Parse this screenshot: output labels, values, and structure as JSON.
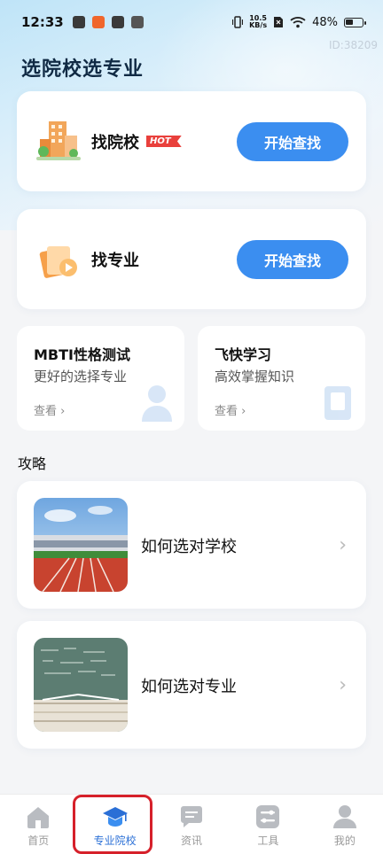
{
  "status_bar": {
    "time": "12:33",
    "net_speed_value": "10.5",
    "net_speed_unit": "KB/s",
    "battery": "48%"
  },
  "watermark": "ID:38209",
  "page_title": "选院校选专业",
  "find_school": {
    "label": "找院校",
    "badge": "HOT",
    "button": "开始查找"
  },
  "find_major": {
    "label": "找专业",
    "button": "开始查找"
  },
  "mbti": {
    "title": "MBTI性格测试",
    "subtitle": "更好的选择专业",
    "link": "查看 ›"
  },
  "fast_learn": {
    "title": "飞快学习",
    "subtitle": "高效掌握知识",
    "link": "查看 ›"
  },
  "guides": {
    "section_title": "攻略",
    "items": [
      {
        "label": "如何选对学校"
      },
      {
        "label": "如何选对专业"
      }
    ]
  },
  "tabbar": {
    "items": [
      {
        "label": "首页",
        "icon": "home-icon"
      },
      {
        "label": "专业院校",
        "icon": "graduation-cap-icon",
        "active": true
      },
      {
        "label": "资讯",
        "icon": "message-icon"
      },
      {
        "label": "工具",
        "icon": "tools-icon"
      },
      {
        "label": "我的",
        "icon": "user-icon"
      }
    ]
  },
  "colors": {
    "accent": "#3b8ef0",
    "hot": "#e9403c",
    "active_tab": "#2a6fd6",
    "highlight_outline": "#d6202a"
  }
}
